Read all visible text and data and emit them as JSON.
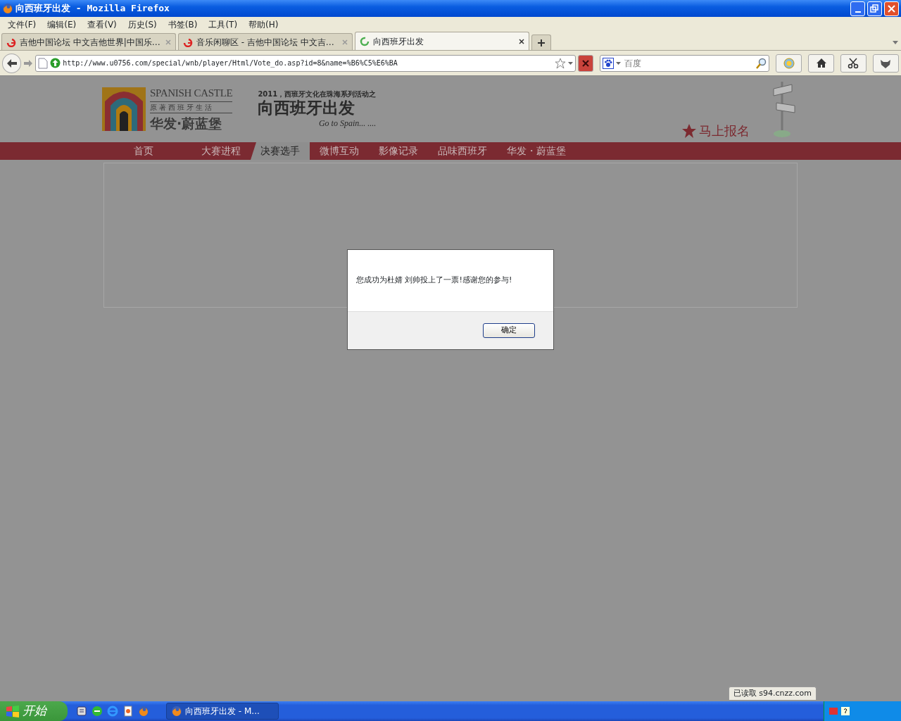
{
  "window": {
    "title": "向西班牙出发 - Mozilla Firefox"
  },
  "menu": [
    "文件(F)",
    "编辑(E)",
    "查看(V)",
    "历史(S)",
    "书签(B)",
    "工具(T)",
    "帮助(H)"
  ],
  "tabs": [
    {
      "label": "吉他中国论坛 中文吉他世界|中国乐…",
      "selected": false,
      "kind": "site"
    },
    {
      "label": "音乐闲聊区 - 吉他中国论坛 中文吉…",
      "selected": false,
      "kind": "site"
    },
    {
      "label": "向西班牙出发",
      "selected": true,
      "kind": "loading"
    }
  ],
  "address": {
    "url": "http://www.u0756.com/special/wnb/player/Html/Vote_do.asp?id=8&name=%B6%C5%E6%BA"
  },
  "search": {
    "placeholder": "百度"
  },
  "site": {
    "logo_title": "SPANISH CASTLE",
    "logo_subtitle": "原著西班牙生活",
    "logo_name": "华发·蔚蓝堡",
    "event_caption": "2011，西班牙文化在珠海系列活动之",
    "event_title": "向西班牙出发",
    "event_slogan": "Go to Spain... ....",
    "signup": "马上报名",
    "nav": [
      {
        "label": "首页",
        "selected": false
      },
      {
        "label": "大赛进程",
        "selected": false
      },
      {
        "label": "决赛选手",
        "selected": true
      },
      {
        "label": "微博互动",
        "selected": false
      },
      {
        "label": "影像记录",
        "selected": false
      },
      {
        "label": "品味西班牙",
        "selected": false
      },
      {
        "label": "华发・蔚蓝堡",
        "selected": false
      }
    ]
  },
  "dialog": {
    "message": "您成功为杜婧 刘帅投上了一票!感谢您的参与!",
    "button": "确定"
  },
  "status_bar": {
    "text": "已读取 s94.cnzz.com"
  },
  "taskbar": {
    "start": "开始",
    "tasks": [
      "向西班牙出发 - M..."
    ]
  }
}
